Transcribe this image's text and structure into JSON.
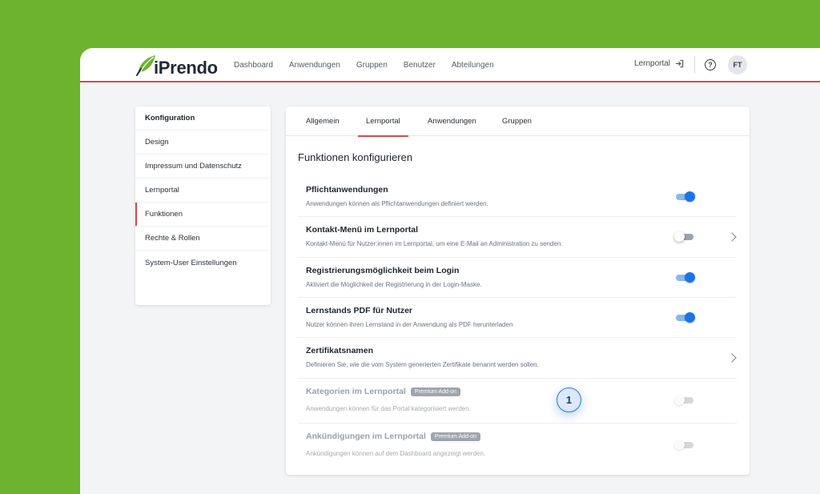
{
  "app": {
    "logo_text": "iPrendo",
    "brand_color": "#6db32f",
    "accent_color": "#d94848",
    "toggle_color": "#1a73e8"
  },
  "topnav": {
    "items": [
      "Dashboard",
      "Anwendungen",
      "Gruppen",
      "Benutzer",
      "Abteilungen"
    ],
    "lernportal_label": "Lernportal",
    "lernportal_icon": "sign-in-icon",
    "help_icon": "help-circle-icon",
    "avatar_initials": "FT"
  },
  "sidebar": {
    "header": "Konfiguration",
    "items": [
      "Design",
      "Impressum und Datenschutz",
      "Lernportal",
      "Funktionen",
      "Rechte & Rollen",
      "System-User Einstellungen"
    ],
    "active": "Funktionen"
  },
  "tabs": {
    "items": [
      "Allgemein",
      "Lernportal",
      "Anwendungen",
      "Gruppen"
    ],
    "active": "Lernportal"
  },
  "main": {
    "title": "Funktionen konfigurieren",
    "rows": [
      {
        "title": "Pflichtanwendungen",
        "desc": "Anwendungen können als Pflichtanwendungen definiert werden.",
        "toggle": "on"
      },
      {
        "title": "Kontakt-Menü im Lernportal",
        "desc": "Kontakt-Menü für Nutzer:innen im Lernportal, um eine E-Mail an Administration zu senden.",
        "toggle": "off",
        "chevron": true
      },
      {
        "title": "Registrierungsmöglichkeit beim Login",
        "desc": "Aktiviert die Möglichkeit der Registrierung in der Login-Maske.",
        "toggle": "on"
      },
      {
        "title": "Lernstands PDF für Nutzer",
        "desc": "Nutzer können ihren Lernstand in der Anwendung als PDF herunterladen",
        "toggle": "on"
      },
      {
        "title": "Zertifikatsnamen",
        "desc": "Definieren Sie, wie die vom System generierten Zertifikate benannt werden sollen.",
        "chevron": true
      },
      {
        "title": "Kategorien im Lernportal",
        "badge": "Premium Add-on",
        "desc": "Anwendungen können für das Portal kategorisiert werden.",
        "toggle": "disabled"
      },
      {
        "title": "Ankündigungen im Lernportal",
        "badge": "Premium Add-on",
        "desc": "Ankündigungen können auf dem Dashboard angezeigt werden.",
        "toggle": "disabled"
      }
    ]
  },
  "step_marker": {
    "label": "1"
  }
}
